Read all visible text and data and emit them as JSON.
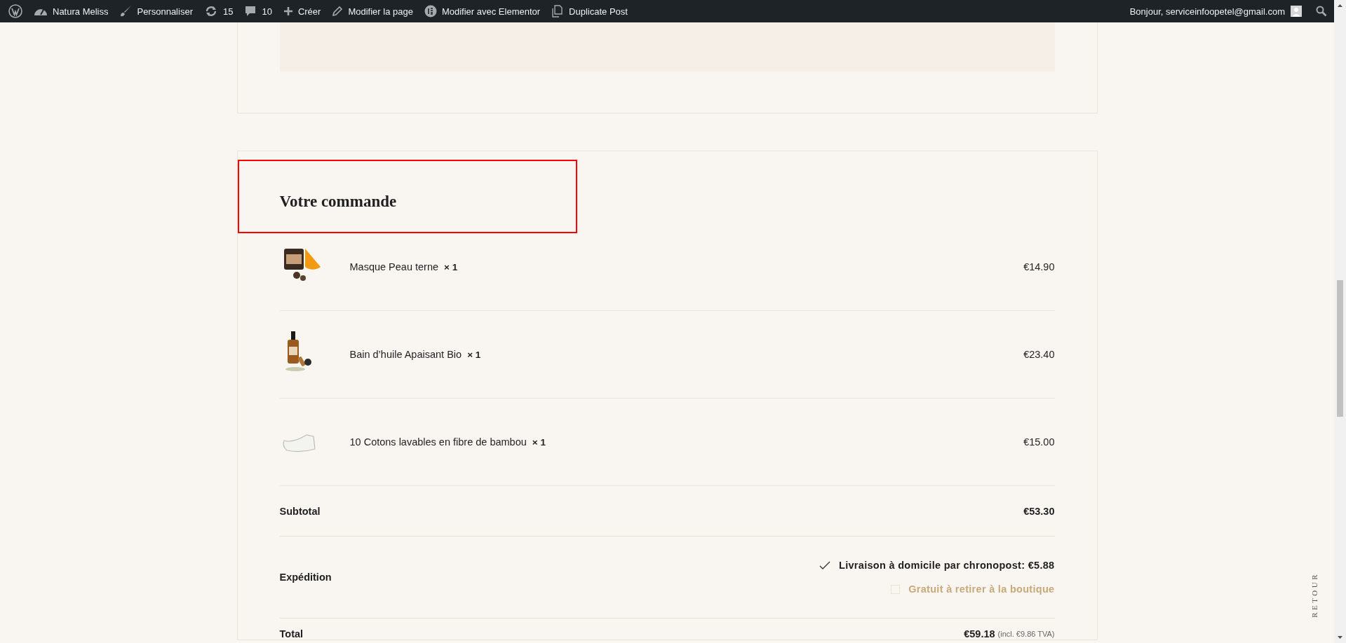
{
  "admin_bar": {
    "items": [
      {
        "kind": "wordpress"
      },
      {
        "kind": "site",
        "label": "Natura Meliss"
      },
      {
        "kind": "customize",
        "label": "Personnaliser"
      },
      {
        "kind": "updates",
        "label": "15"
      },
      {
        "kind": "comments",
        "label": "10"
      },
      {
        "kind": "new",
        "label": "Créer"
      },
      {
        "kind": "edit",
        "label": "Modifier la page"
      },
      {
        "kind": "elementor",
        "label": "Modifier avec Elementor"
      },
      {
        "kind": "duplicate",
        "label": "Duplicate Post"
      }
    ],
    "greeting": "Bonjour, serviceinfoopetel@gmail.com"
  },
  "order": {
    "title": "Votre commande",
    "items": [
      {
        "kind": "jar",
        "name": "Masque Peau terne",
        "quantity": "× 1",
        "price": "€14.90"
      },
      {
        "kind": "bottle",
        "name": "Bain d’huile Apaisant Bio",
        "quantity": "× 1",
        "price": "€23.40"
      },
      {
        "kind": "pad",
        "name": "10 Cotons lavables en fibre de bambou",
        "quantity": "× 1",
        "price": "€15.00"
      }
    ],
    "subtotal": {
      "label": "Subtotal",
      "value": "€53.30"
    },
    "shipping": {
      "label": "Expédition",
      "options": [
        {
          "label": "Livraison à domicile par chronopost: **€5.88**",
          "selected": true
        },
        {
          "label": "Gratuit à retirer à la boutique",
          "selected": false
        }
      ]
    },
    "total": {
      "label": "Total",
      "value": "€59.18",
      "tax_note": "(incl. €9.86 TVA)"
    }
  },
  "back_link": "RETOUR"
}
